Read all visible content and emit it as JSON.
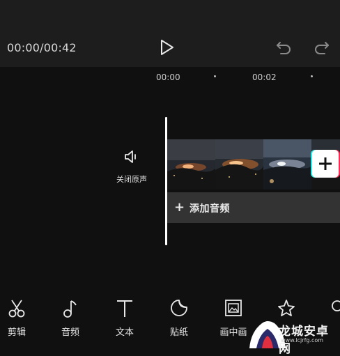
{
  "header": {
    "time_display": "00:00/00:42",
    "play_icon": "play-icon",
    "undo_icon": "undo-icon",
    "redo_icon": "redo-icon"
  },
  "ruler": {
    "ticks": [
      "00:00",
      "00:02"
    ]
  },
  "timeline": {
    "mute_label": "关闭原声",
    "add_audio_label": "添加音频",
    "add_audio_symbol": "+",
    "add_clip_symbol": "+"
  },
  "toolbar": {
    "items": [
      {
        "label": "剪辑",
        "icon": "scissors-icon"
      },
      {
        "label": "音频",
        "icon": "music-note-icon"
      },
      {
        "label": "文本",
        "icon": "text-icon"
      },
      {
        "label": "贴纸",
        "icon": "sticker-icon"
      },
      {
        "label": "画中画",
        "icon": "picture-in-picture-icon"
      },
      {
        "label": "",
        "icon": "effects-star-icon"
      },
      {
        "label": "",
        "icon": "filter-icon"
      }
    ]
  },
  "watermark": {
    "text": "龙城安卓网",
    "url": "www.lcjrfg.com"
  },
  "colors": {
    "background": "#101010",
    "topbar": "#1d1d1d",
    "audio_bar": "#333333",
    "accent_cyan": "#25f4ee",
    "accent_pink": "#fe2c55"
  }
}
